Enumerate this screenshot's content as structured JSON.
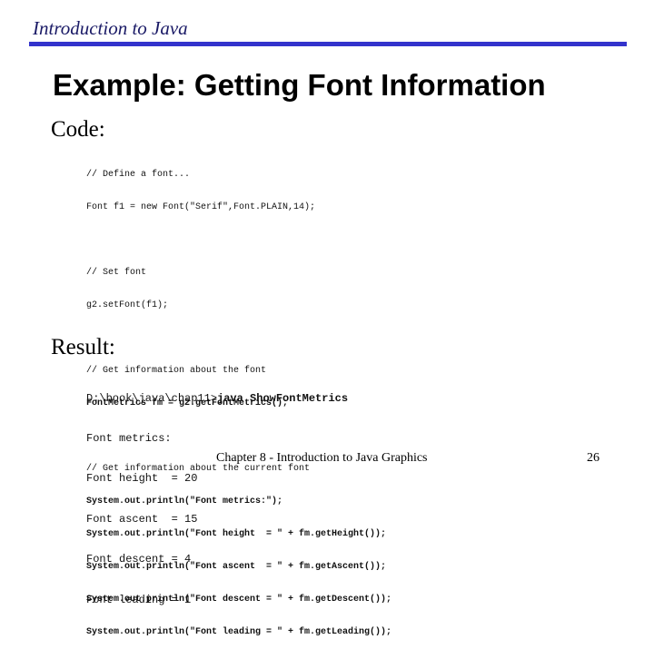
{
  "header": {
    "title": "Introduction to Java"
  },
  "slide": {
    "title": "Example:  Getting Font Information"
  },
  "code_section": {
    "label": "Code:",
    "lines": {
      "l1": "// Define a font...",
      "l2": "Font f1 = new Font(\"Serif\",Font.PLAIN,14);",
      "l3": "// Set font",
      "l4": "g2.setFont(f1);",
      "l5": "// Get information about the font",
      "l6": "FontMetrics fm = g2.getFontMetrics();",
      "l7": "// Get information about the current font",
      "l8": "System.out.println(\"Font metrics:\");",
      "l9": "System.out.println(\"Font height  = \" + fm.getHeight());",
      "l10": "System.out.println(\"Font ascent  = \" + fm.getAscent());",
      "l11": "System.out.println(\"Font descent = \" + fm.getDescent());",
      "l12": "System.out.println(\"Font leading = \" + fm.getLeading());"
    }
  },
  "result_section": {
    "label": "Result:",
    "prompt": "D:\\book\\java\\chap11>",
    "command": "java ShowFontMetrics",
    "lines": {
      "r1": "Font metrics:",
      "r2": "Font height  = 20",
      "r3": "Font ascent  = 15",
      "r4": "Font descent = 4",
      "r5": "Font leading = 1"
    }
  },
  "footer": {
    "text": "Chapter 8 - Introduction to Java Graphics",
    "page_number": "26"
  }
}
